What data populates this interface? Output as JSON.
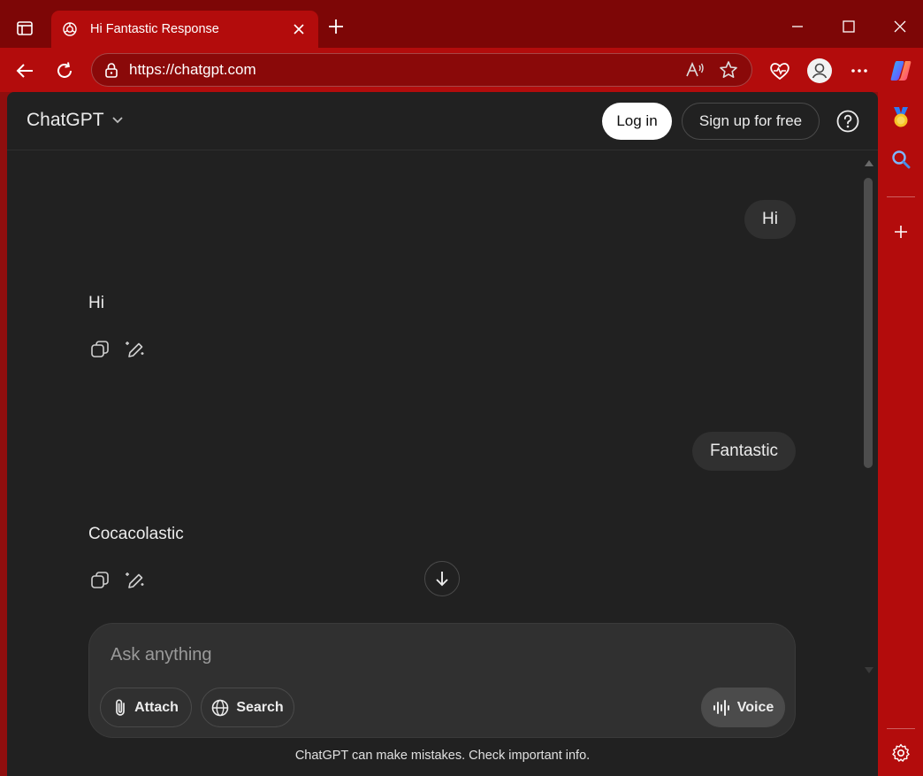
{
  "browser": {
    "tab_title": "Hi Fantastic Response",
    "url": "https://chatgpt.com",
    "colors": {
      "frame": "#b30c0c",
      "titlebar": "#7d0606"
    }
  },
  "header": {
    "model_name": "ChatGPT",
    "login_label": "Log in",
    "signup_label": "Sign up for free"
  },
  "conversation": [
    {
      "role": "user",
      "text": "Hi"
    },
    {
      "role": "assistant",
      "text": "Hi"
    },
    {
      "role": "user",
      "text": "Fantastic"
    },
    {
      "role": "assistant",
      "text": "Cocacolastic"
    }
  ],
  "composer": {
    "placeholder": "Ask anything",
    "attach_label": "Attach",
    "search_label": "Search",
    "voice_label": "Voice"
  },
  "footer": {
    "disclaimer": "ChatGPT can make mistakes. Check important info."
  },
  "icons": {
    "tab_actions": "tab-actions-icon",
    "favicon": "openai-logo-icon",
    "back": "back-arrow-icon",
    "refresh": "refresh-icon",
    "lock": "site-info-lock-icon",
    "read_aloud": "read-aloud-icon",
    "favorite": "star-icon",
    "health": "browser-essentials-icon",
    "profile": "profile-icon",
    "more": "more-icon",
    "copilot": "copilot-icon",
    "copy": "copy-icon",
    "edit": "edit-icon",
    "scroll_down": "arrow-down-icon",
    "help": "help-icon",
    "settings": "settings-icon"
  }
}
